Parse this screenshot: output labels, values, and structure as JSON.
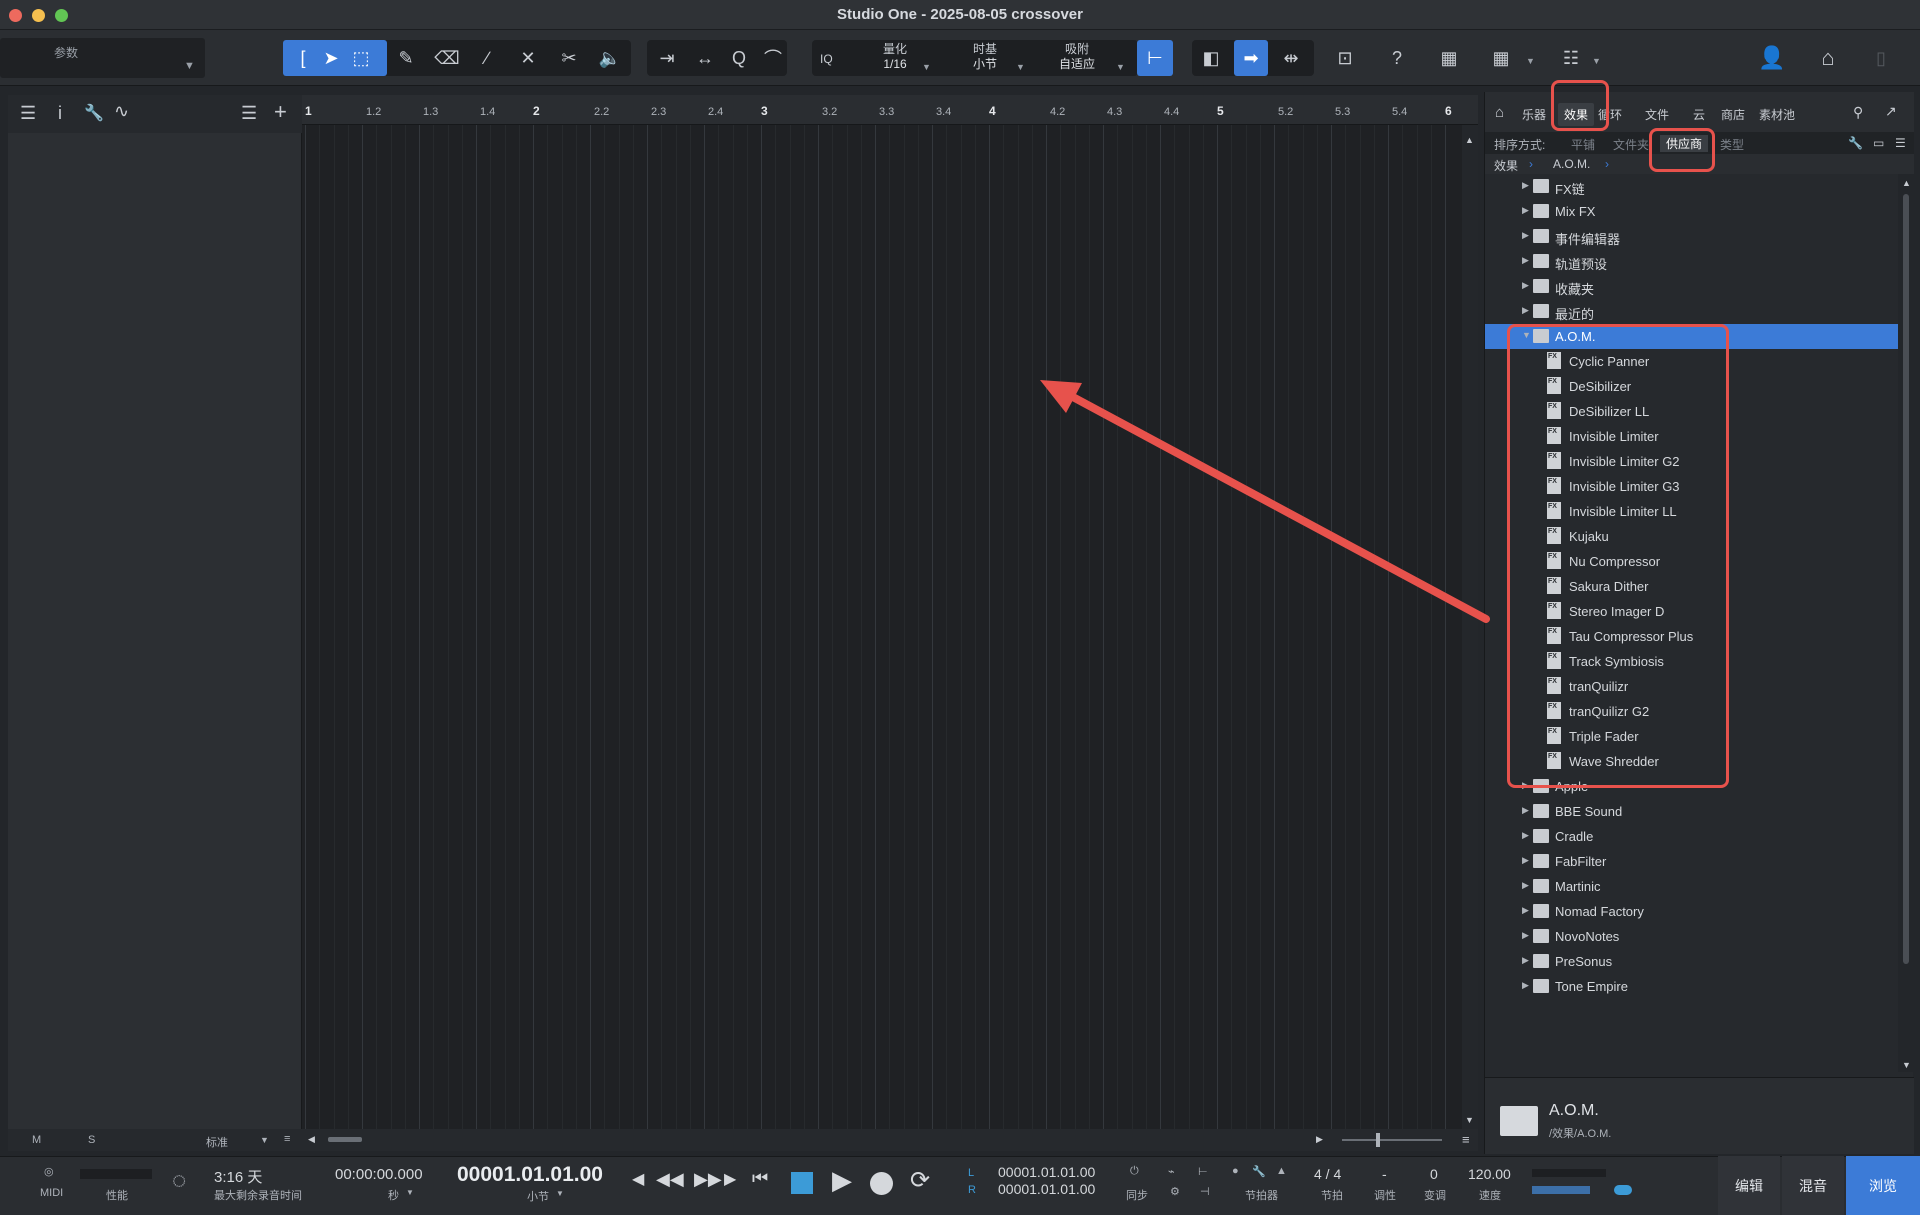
{
  "window": {
    "title": "Studio One - 2025-08-05 crossover"
  },
  "toolbar": {
    "params_label": "参数",
    "quantize_label": "量化",
    "quantize_value": "1/16",
    "timebase_label": "时基",
    "timebase_value": "小节",
    "snap_label": "吸附",
    "snap_value": "自适应",
    "iq_label": "IQ",
    "help_label": "?"
  },
  "ruler": {
    "ticks": [
      "1",
      "1.2",
      "1.3",
      "1.4",
      "2",
      "2.2",
      "2.3",
      "2.4",
      "3",
      "3.2",
      "3.3",
      "3.4",
      "4",
      "4.2",
      "4.3",
      "4.4",
      "5",
      "5.2",
      "5.3",
      "5.4",
      "6"
    ]
  },
  "left_footer": {
    "m": "M",
    "s": "S",
    "mode": "标准"
  },
  "browser": {
    "tabs": [
      "乐器",
      "效果",
      "循环",
      "文件",
      "云",
      "商店",
      "素材池"
    ],
    "selected_tab": "效果",
    "sort_label": "排序方式:",
    "sort_options": [
      "平铺",
      "文件夹",
      "供应商",
      "类型"
    ],
    "selected_sort": "供应商",
    "breadcrumb": [
      "效果",
      "A.O.M."
    ],
    "items_top": [
      {
        "label": "FX链",
        "icon": "fx-chain-icon"
      },
      {
        "label": "Mix FX",
        "icon": "folder-icon"
      },
      {
        "label": "事件编辑器",
        "icon": "folder-icon"
      },
      {
        "label": "轨道预设",
        "icon": "folder-icon"
      },
      {
        "label": "收藏夹",
        "icon": "star-icon"
      },
      {
        "label": "最近的",
        "icon": "clock-icon"
      }
    ],
    "selected_folder": "A.O.M.",
    "aom_plugins": [
      "Cyclic Panner",
      "DeSibilizer",
      "DeSibilizer LL",
      "Invisible Limiter",
      "Invisible Limiter G2",
      "Invisible Limiter G3",
      "Invisible Limiter LL",
      "Kujaku",
      "Nu Compressor",
      "Sakura Dither",
      "Stereo Imager D",
      "Tau Compressor Plus",
      "Track Symbiosis",
      "tranQuilizr",
      "tranQuilizr G2",
      "Triple Fader",
      "Wave Shredder"
    ],
    "items_bottom": [
      "Apple",
      "BBE Sound",
      "Cradle",
      "FabFilter",
      "Martinic",
      "Nomad Factory",
      "NovoNotes",
      "PreSonus",
      "Tone Empire"
    ],
    "info_title": "A.O.M.",
    "info_path": "/效果/A.O.M."
  },
  "transport": {
    "midi": "MIDI",
    "perf": "性能",
    "record_time": "3:16 天",
    "record_time_label": "最大剩余录音时间",
    "seconds": "00:00:00.000",
    "seconds_label": "秒",
    "bars": "00001.01.01.00",
    "bars_label": "小节",
    "l_label": "L",
    "r_label": "R",
    "loop_l": "00001.01.01.00",
    "loop_r": "00001.01.01.00",
    "sync_label": "同步",
    "metronome_label": "节拍器",
    "signature": "4 / 4",
    "signature_label": "节拍",
    "key": "-",
    "key_label": "调性",
    "transpose": "0",
    "transpose_label": "变调",
    "tempo": "120.00",
    "tempo_label": "速度",
    "btn_edit": "编辑",
    "btn_mix": "混音",
    "btn_browse": "浏览"
  },
  "colors": {
    "accent": "#3c7bd7",
    "annotation": "#e7524c"
  }
}
